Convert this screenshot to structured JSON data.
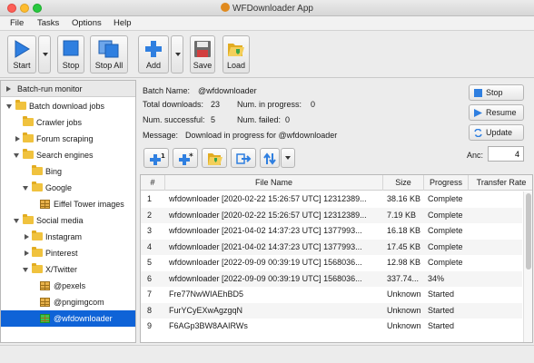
{
  "window": {
    "title": "WFDownloader App"
  },
  "menu": [
    "File",
    "Tasks",
    "Options",
    "Help"
  ],
  "toolbar": {
    "start": "Start",
    "stop": "Stop",
    "stop_all": "Stop All",
    "add": "Add",
    "save": "Save",
    "load": "Load"
  },
  "tree": {
    "header": "Batch-run monitor",
    "items": [
      {
        "label": "Batch download jobs",
        "icon": "folder-icon"
      },
      {
        "label": "Crawler jobs",
        "icon": "folder-icon"
      },
      {
        "label": "Forum scraping",
        "icon": "folder-icon"
      },
      {
        "label": "Search engines",
        "icon": "folder-icon"
      },
      {
        "label": "Bing",
        "icon": "folder-icon"
      },
      {
        "label": "Google",
        "icon": "folder-icon"
      },
      {
        "label": "Eiffel Tower images",
        "icon": "job-icon"
      },
      {
        "label": "Social media",
        "icon": "folder-icon"
      },
      {
        "label": "Instagram",
        "icon": "folder-icon"
      },
      {
        "label": "Pinterest",
        "icon": "folder-icon"
      },
      {
        "label": "X/Twitter",
        "icon": "folder-icon"
      },
      {
        "label": "@pexels",
        "icon": "job-icon"
      },
      {
        "label": "@pngimgcom",
        "icon": "job-icon"
      },
      {
        "label": "@wfdownloader",
        "icon": "job-icon-active"
      }
    ]
  },
  "batch": {
    "name_label": "Batch Name:",
    "name_value": "@wfdownloader",
    "total_label": "Total downloads:",
    "total_value": "23",
    "in_progress_label": "Num. in progress:",
    "in_progress_value": "0",
    "successful_label": "Num. successful:",
    "successful_value": "5",
    "failed_label": "Num. failed:",
    "failed_value": "0",
    "message_label": "Message:",
    "message_value": "Download in progress for @wfdownloader"
  },
  "side_buttons": {
    "stop": "Stop",
    "resume": "Resume",
    "update": "Update"
  },
  "anc": {
    "label": "Anc:",
    "value": "4"
  },
  "table": {
    "columns": [
      "#",
      "File Name",
      "Size",
      "Progress",
      "Transfer Rate"
    ],
    "rows": [
      [
        "1",
        "wfdownloader [2020-02-22 15:26:57 UTC] 12312389...",
        "38.16 KB",
        "Complete",
        ""
      ],
      [
        "2",
        "wfdownloader [2020-02-22 15:26:57 UTC] 12312389...",
        "7.19 KB",
        "Complete",
        ""
      ],
      [
        "3",
        "wfdownloader [2021-04-02 14:37:23 UTC] 1377993...",
        "16.18 KB",
        "Complete",
        ""
      ],
      [
        "4",
        "wfdownloader [2021-04-02 14:37:23 UTC] 1377993...",
        "17.45 KB",
        "Complete",
        ""
      ],
      [
        "5",
        "wfdownloader [2022-09-09 00:39:19 UTC] 1568036...",
        "12.98 KB",
        "Complete",
        ""
      ],
      [
        "6",
        "wfdownloader [2022-09-09 00:39:19 UTC] 1568036...",
        "337.74...",
        "34%",
        ""
      ],
      [
        "7",
        "Fre77NwWIAEhBD5",
        "Unknown",
        "Started",
        ""
      ],
      [
        "8",
        "FurYCyEXwAgzgqN",
        "Unknown",
        "Started",
        ""
      ],
      [
        "9",
        "F6AGp3BW8AAIRWs",
        "Unknown",
        "Started",
        ""
      ]
    ]
  },
  "colors": {
    "accent": "#0f63d7",
    "brand": "#e08a1e"
  }
}
